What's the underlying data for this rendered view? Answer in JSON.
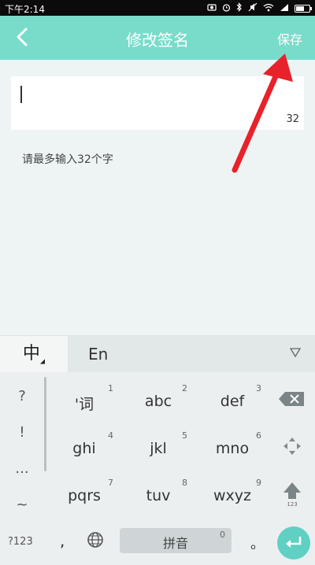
{
  "status": {
    "time": "下午2:14",
    "icons": [
      "camera-icon",
      "alarm-icon",
      "bluetooth-icon",
      "silent-icon",
      "wifi-icon",
      "signal-icon",
      "battery-icon"
    ]
  },
  "titlebar": {
    "title": "修改签名",
    "save_label": "保存"
  },
  "signature": {
    "value": "",
    "remaining": "32",
    "hint": "请最多输入32个字"
  },
  "keyboard": {
    "lang_zh": "中",
    "lang_en": "En",
    "left_symbols": [
      "?",
      "!",
      "...",
      "~"
    ],
    "keys": [
      {
        "label": "'词",
        "num": "1"
      },
      {
        "label": "abc",
        "num": "2"
      },
      {
        "label": "def",
        "num": "3"
      },
      {
        "label": "ghi",
        "num": "4"
      },
      {
        "label": "jkl",
        "num": "5"
      },
      {
        "label": "mno",
        "num": "6"
      },
      {
        "label": "pqrs",
        "num": "7"
      },
      {
        "label": "tuv",
        "num": "8"
      },
      {
        "label": "wxyz",
        "num": "9"
      }
    ],
    "shift_sub": "123",
    "bottom": {
      "sym_label": "?123",
      "comma": ",",
      "space_label": "拼音",
      "space_num": "0",
      "period": "。"
    }
  },
  "colors": {
    "accent": "#79dccb",
    "enter": "#5fd0c3",
    "annotation_arrow": "#e8212a"
  }
}
